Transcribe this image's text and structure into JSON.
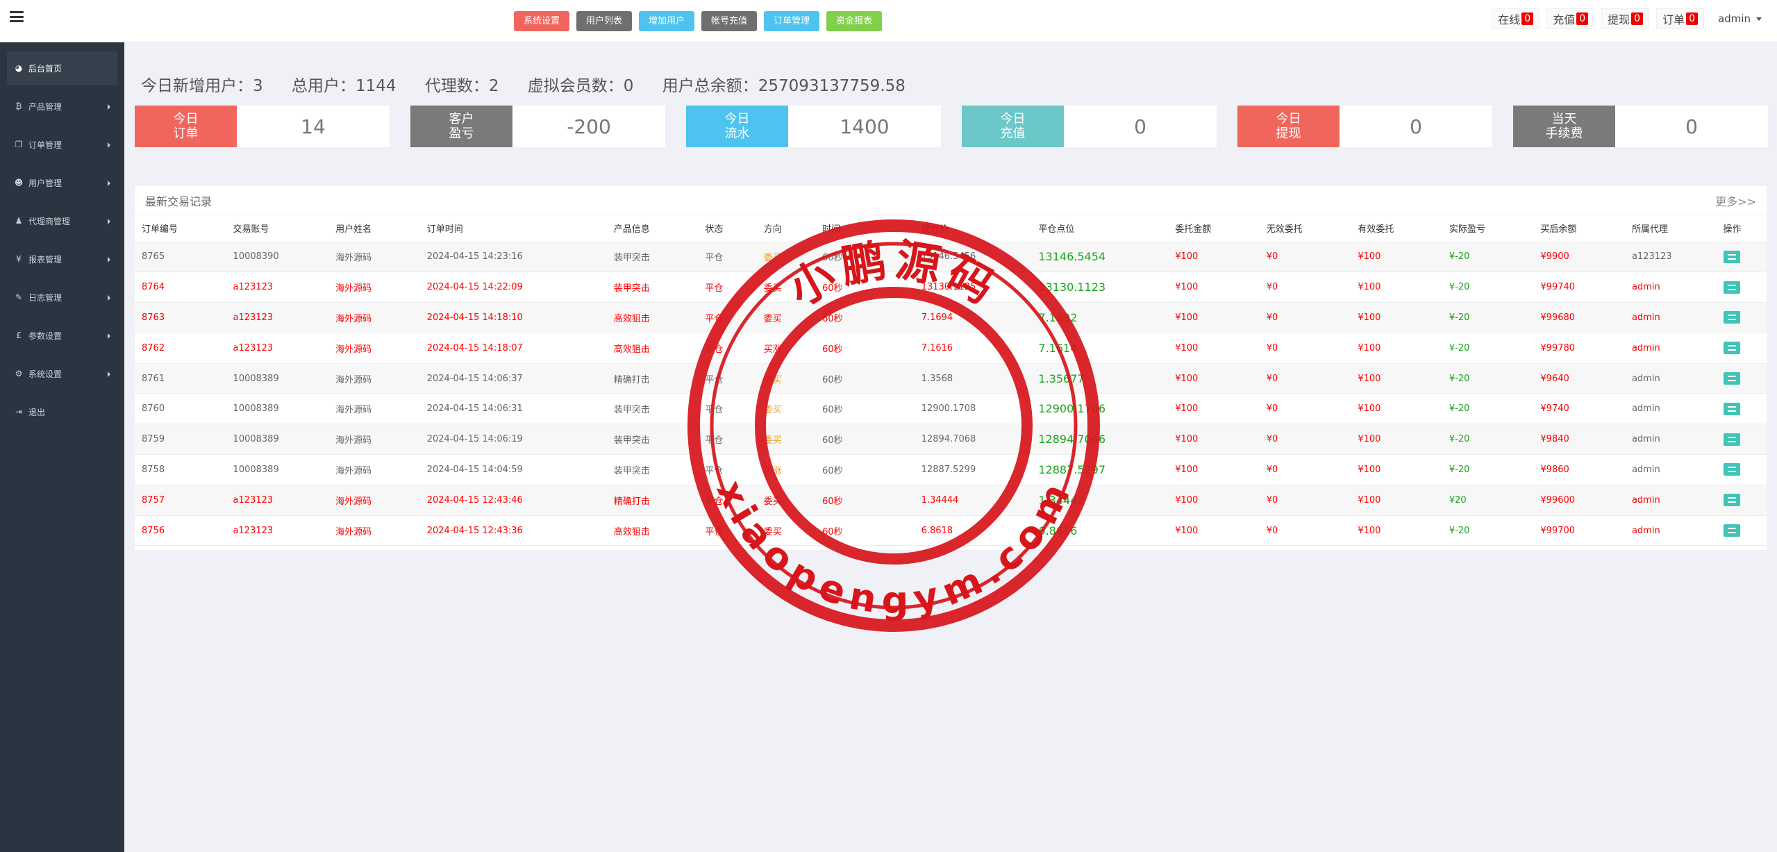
{
  "topbar": {
    "nav": [
      {
        "label": "系统设置",
        "color": "#f0665d"
      },
      {
        "label": "用户列表",
        "color": "#6f6f6f"
      },
      {
        "label": "增加用户",
        "color": "#4fc3ef"
      },
      {
        "label": "帐号充值",
        "color": "#6f6f6f"
      },
      {
        "label": "订单管理",
        "color": "#4fc3ef"
      },
      {
        "label": "资金报表",
        "color": "#80d04a"
      }
    ],
    "right": [
      {
        "label": "在线",
        "count": "0"
      },
      {
        "label": "充值",
        "count": "0"
      },
      {
        "label": "提现",
        "count": "0"
      },
      {
        "label": "订单",
        "count": "0"
      }
    ],
    "admin": "admin"
  },
  "sidebar": {
    "items": [
      {
        "label": "后台首页",
        "icon": "dashboard-icon",
        "glyph": "◕",
        "active": true,
        "arrow": false
      },
      {
        "label": "产品管理",
        "icon": "bitcoin-icon",
        "glyph": "₿",
        "active": false,
        "arrow": true
      },
      {
        "label": "订单管理",
        "icon": "copy-icon",
        "glyph": "❐",
        "active": false,
        "arrow": true
      },
      {
        "label": "用户管理",
        "icon": "user-icon",
        "glyph": "☻",
        "active": false,
        "arrow": true
      },
      {
        "label": "代理商管理",
        "icon": "agent-icon",
        "glyph": "♟",
        "active": false,
        "arrow": true
      },
      {
        "label": "报表管理",
        "icon": "yen-icon",
        "glyph": "¥",
        "active": false,
        "arrow": true
      },
      {
        "label": "日志管理",
        "icon": "tag-icon",
        "glyph": "✎",
        "active": false,
        "arrow": true
      },
      {
        "label": "参数设置",
        "icon": "pound-icon",
        "glyph": "£",
        "active": false,
        "arrow": true
      },
      {
        "label": "系统设置",
        "icon": "cogs-icon",
        "glyph": "⚙",
        "active": false,
        "arrow": true
      },
      {
        "label": "退出",
        "icon": "sign-out-icon",
        "glyph": "⇥",
        "active": false,
        "arrow": false
      }
    ]
  },
  "stats": {
    "new_users": "今日新增用户：3",
    "total_users": "总用户：1144",
    "agents": "代理数：2",
    "virtual": "虚拟会员数：0",
    "balance": "用户总余额：257093137759.58"
  },
  "cards": [
    {
      "label1": "今日",
      "label2": "订单",
      "value": "14",
      "color": "#f0665d"
    },
    {
      "label1": "客户",
      "label2": "盈亏",
      "value": "-200",
      "color": "#7a7a7a"
    },
    {
      "label1": "今日",
      "label2": "流水",
      "value": "1400",
      "color": "#4fc3ef"
    },
    {
      "label1": "今日",
      "label2": "充值",
      "value": "0",
      "color": "#6cc8c8"
    },
    {
      "label1": "今日",
      "label2": "提现",
      "value": "0",
      "color": "#f0665d"
    },
    {
      "label1": "当天",
      "label2": "手续费",
      "value": "0",
      "color": "#7a7a7a"
    }
  ],
  "panel": {
    "title": "最新交易记录",
    "more": "更多>>"
  },
  "table": {
    "headers": [
      "订单编号",
      "交易账号",
      "用户姓名",
      "订单时间",
      "产品信息",
      "状态",
      "方向",
      "时间",
      "建仓价",
      "平仓点位",
      "委托金额",
      "无效委托",
      "有效委托",
      "实际盈亏",
      "买后余额",
      "所属代理",
      "操作"
    ],
    "rows": [
      {
        "hl": false,
        "cells": [
          "8765",
          "10008390",
          "海外源码",
          "2024-04-15 14:23:16",
          "装甲突击",
          "平仓",
          "委买",
          "60秒",
          "13146.5456",
          "13146.5454",
          "¥100",
          "¥0",
          "¥100",
          "¥-20",
          "¥9900",
          "a123123"
        ]
      },
      {
        "hl": true,
        "cells": [
          "8764",
          "a123123",
          "海外源码",
          "2024-04-15 14:22:09",
          "装甲突击",
          "平仓",
          "委买",
          "60秒",
          "13130.1125",
          "13130.1123",
          "¥100",
          "¥0",
          "¥100",
          "¥-20",
          "¥99740",
          "admin"
        ]
      },
      {
        "hl": true,
        "cells": [
          "8763",
          "a123123",
          "海外源码",
          "2024-04-15 14:18:10",
          "高效狙击",
          "平仓",
          "委买",
          "60秒",
          "7.1694",
          "7.1692",
          "¥100",
          "¥0",
          "¥100",
          "¥-20",
          "¥99680",
          "admin"
        ]
      },
      {
        "hl": true,
        "cells": [
          "8762",
          "a123123",
          "海外源码",
          "2024-04-15 14:18:07",
          "高效狙击",
          "平仓",
          "买涨",
          "60秒",
          "7.1616",
          "7.1614",
          "¥100",
          "¥0",
          "¥100",
          "¥-20",
          "¥99780",
          "admin"
        ]
      },
      {
        "hl": false,
        "cells": [
          "8761",
          "10008389",
          "海外源码",
          "2024-04-15 14:06:37",
          "精确打击",
          "平仓",
          "委买",
          "60秒",
          "1.3568",
          "1.35677",
          "¥100",
          "¥0",
          "¥100",
          "¥-20",
          "¥9640",
          "admin"
        ]
      },
      {
        "hl": false,
        "cells": [
          "8760",
          "10008389",
          "海外源码",
          "2024-04-15 14:06:31",
          "装甲突击",
          "平仓",
          "委买",
          "60秒",
          "12900.1708",
          "12900.1706",
          "¥100",
          "¥0",
          "¥100",
          "¥-20",
          "¥9740",
          "admin"
        ]
      },
      {
        "hl": false,
        "cells": [
          "8759",
          "10008389",
          "海外源码",
          "2024-04-15 14:06:19",
          "装甲突击",
          "平仓",
          "委买",
          "60秒",
          "12894.7068",
          "12894.7066",
          "¥100",
          "¥0",
          "¥100",
          "¥-20",
          "¥9840",
          "admin"
        ]
      },
      {
        "hl": false,
        "cells": [
          "8758",
          "10008389",
          "海外源码",
          "2024-04-15 14:04:59",
          "装甲突击",
          "平仓",
          "买涨",
          "60秒",
          "12887.5299",
          "12887.5297",
          "¥100",
          "¥0",
          "¥100",
          "¥-20",
          "¥9860",
          "admin"
        ]
      },
      {
        "hl": true,
        "cells": [
          "8757",
          "a123123",
          "海外源码",
          "2024-04-15 12:43:46",
          "精确打击",
          "平仓",
          "委买",
          "60秒",
          "1.34444",
          "1.34442",
          "¥100",
          "¥0",
          "¥100",
          "¥20",
          "¥99600",
          "admin"
        ]
      },
      {
        "hl": true,
        "cells": [
          "8756",
          "a123123",
          "海外源码",
          "2024-04-15 12:43:36",
          "高效狙击",
          "平仓",
          "委买",
          "60秒",
          "6.8618",
          "6.8616",
          "¥100",
          "¥0",
          "¥100",
          "¥-20",
          "¥99700",
          "admin"
        ]
      }
    ]
  },
  "stamp": {
    "top_text": "小鹏源码",
    "bottom_text": "xiaopengym.com",
    "color": "#d7151b"
  }
}
